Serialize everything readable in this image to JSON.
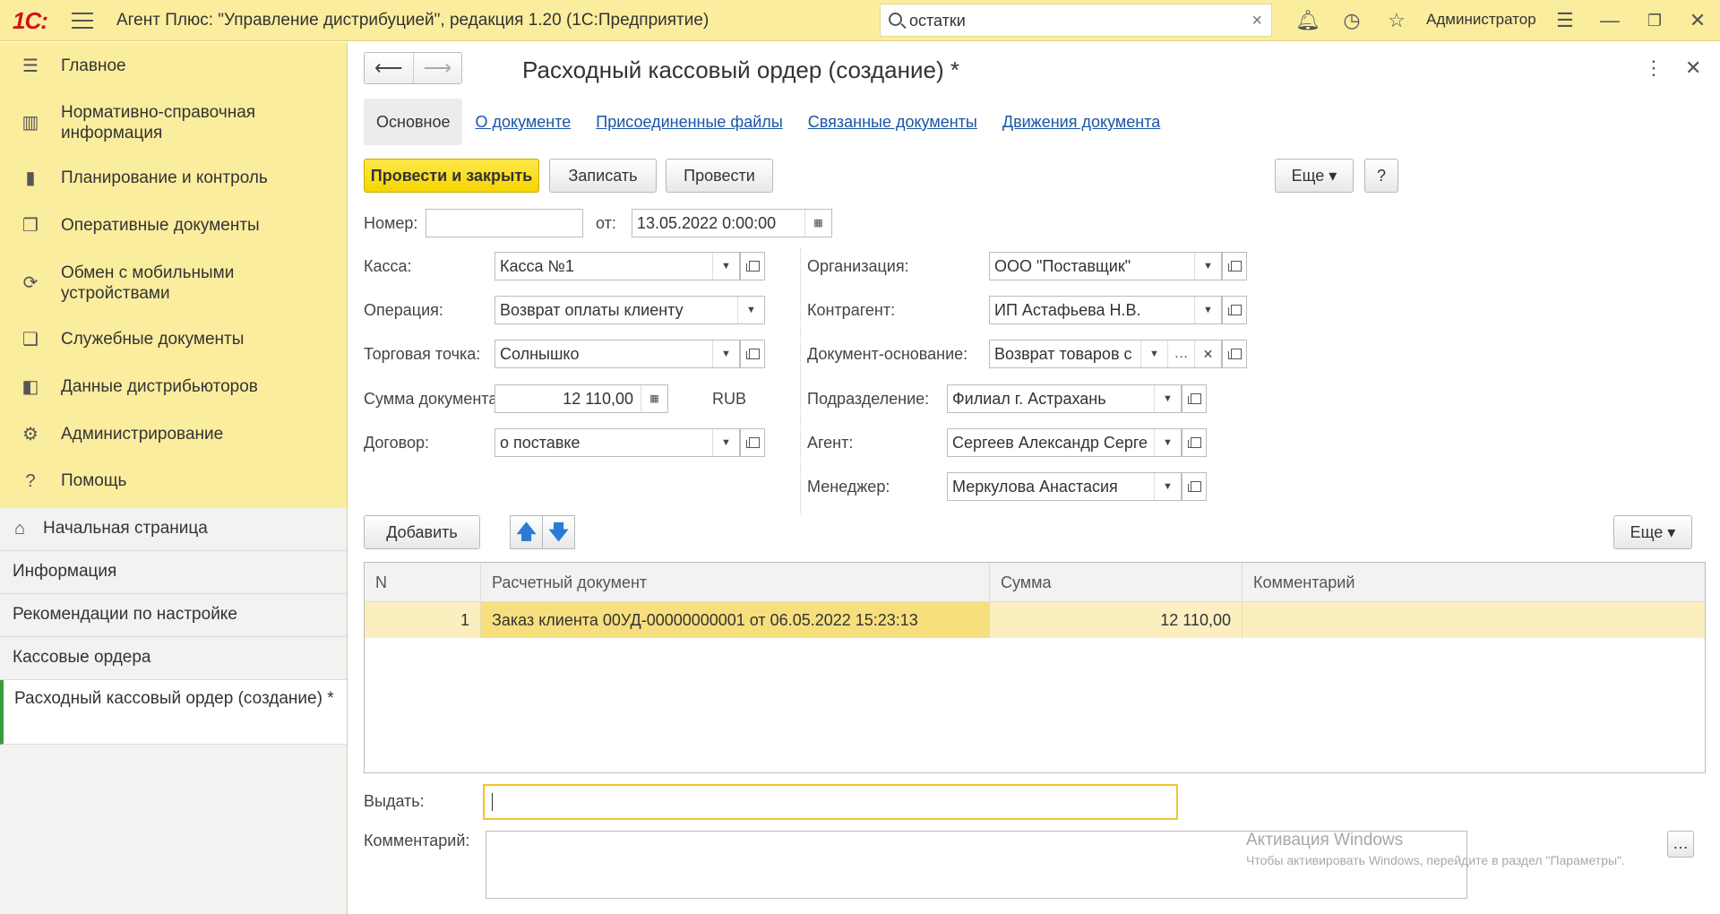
{
  "app": {
    "logo": "1С:",
    "title": "Агент Плюс: \"Управление дистрибуцией\", редакция 1.20  (1С:Предприятие)"
  },
  "search": {
    "value": "остатки"
  },
  "user": {
    "name": "Администратор"
  },
  "sidebar": {
    "sections": [
      {
        "label": "Главное",
        "icon": "hamburger-icon"
      },
      {
        "label": "Нормативно-справочная информация",
        "icon": "reference-icon"
      },
      {
        "label": "Планирование и контроль",
        "icon": "chart-icon"
      },
      {
        "label": "Оперативные документы",
        "icon": "documents-icon"
      },
      {
        "label": "Обмен с мобильными устройствами",
        "icon": "sync-icon"
      },
      {
        "label": "Служебные документы",
        "icon": "service-docs-icon"
      },
      {
        "label": "Данные дистрибьюторов",
        "icon": "distributors-icon"
      },
      {
        "label": "Администрирование",
        "icon": "gear-icon"
      },
      {
        "label": "Помощь",
        "icon": "help-icon"
      }
    ],
    "open_windows": [
      {
        "label": "Начальная страница"
      },
      {
        "label": "Информация"
      },
      {
        "label": "Рекомендации по настройке"
      },
      {
        "label": "Кассовые ордера"
      },
      {
        "label": "Расходный кассовый ордер (создание) *"
      }
    ]
  },
  "document": {
    "title": "Расходный кассовый ордер (создание) *",
    "tabs": [
      "Основное",
      "О документе",
      "Присоединенные файлы",
      "Связанные документы",
      "Движения документа"
    ],
    "toolbar": {
      "post_close": "Провести и закрыть",
      "save": "Записать",
      "post": "Провести",
      "more": "Еще",
      "help": "?"
    },
    "number_label": "Номер:",
    "number_value": "",
    "date_label": "от:",
    "date_value": "13.05.2022  0:00:00",
    "fields_left": [
      {
        "label": "Касса:",
        "value": "Касса №1"
      },
      {
        "label": "Операция:",
        "value": "Возврат оплаты клиенту"
      },
      {
        "label": "Торговая точка:",
        "value": "Солнышко"
      },
      {
        "label": "Сумма документа:",
        "value": "12 110,00",
        "currency": "RUB"
      },
      {
        "label": "Договор:",
        "value": "о поставке"
      }
    ],
    "fields_right": [
      {
        "label": "Организация:",
        "value": "ООО \"Поставщик\""
      },
      {
        "label": "Контрагент:",
        "value": "ИП Астафьева Н.В."
      },
      {
        "label": "Документ-основание:",
        "value": "Возврат товаров с"
      },
      {
        "label": "Подразделение:",
        "value": "Филиал г. Астрахань"
      },
      {
        "label": "Агент:",
        "value": "Сергеев Александр Серге"
      },
      {
        "label": "Менеджер:",
        "value": "Меркулова Анастасия"
      }
    ],
    "table_toolbar": {
      "add": "Добавить",
      "more": "Еще"
    },
    "table": {
      "columns": [
        "N",
        "Расчетный документ",
        "Сумма",
        "Комментарий"
      ],
      "rows": [
        {
          "n": "1",
          "doc": "Заказ клиента 00УД-00000000001 от 06.05.2022 15:23:13",
          "sum": "12 110,00",
          "comment": ""
        }
      ]
    },
    "issue_label": "Выдать:",
    "issue_value": "",
    "comment_label": "Комментарий:",
    "comment_value": ""
  },
  "watermark": {
    "title": "Активация Windows",
    "subtitle": "Чтобы активировать Windows, перейдите в раздел \"Параметры\"."
  }
}
